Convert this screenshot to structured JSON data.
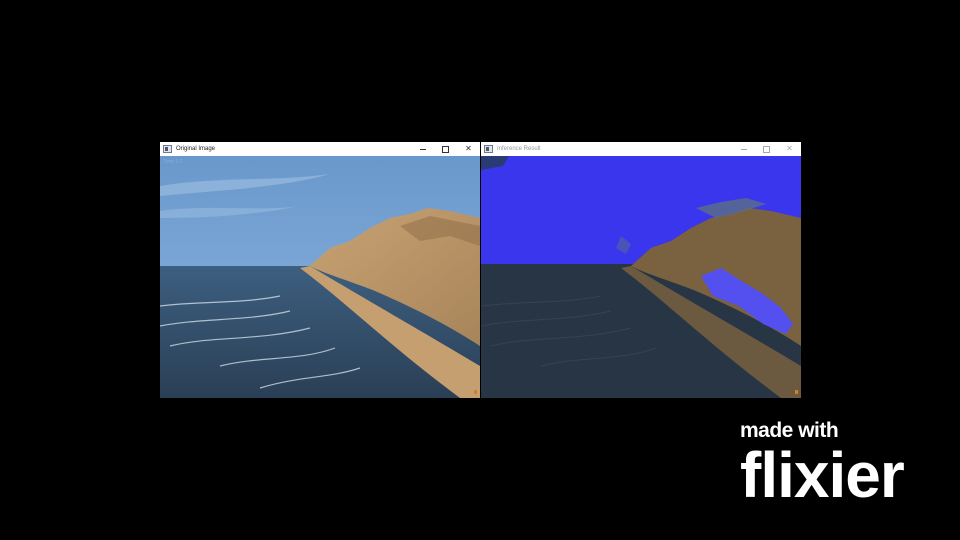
{
  "windows": {
    "original": {
      "title": "Original Image",
      "overlay_text": "Time 1.0",
      "controls": {
        "minimize": "─",
        "maximize": "□",
        "close": "✕"
      }
    },
    "inference": {
      "title": "Inference Result",
      "controls": {
        "minimize": "─",
        "maximize": "□",
        "close": "✕"
      }
    }
  },
  "watermark": {
    "line1": "made with",
    "line2": "flixier"
  },
  "colors": {
    "background": "#000000",
    "sky": "#5a8fc6",
    "sea": "#2f4a63",
    "sand": "#c9a06a",
    "segmentation_blue": "#3a36f0"
  }
}
